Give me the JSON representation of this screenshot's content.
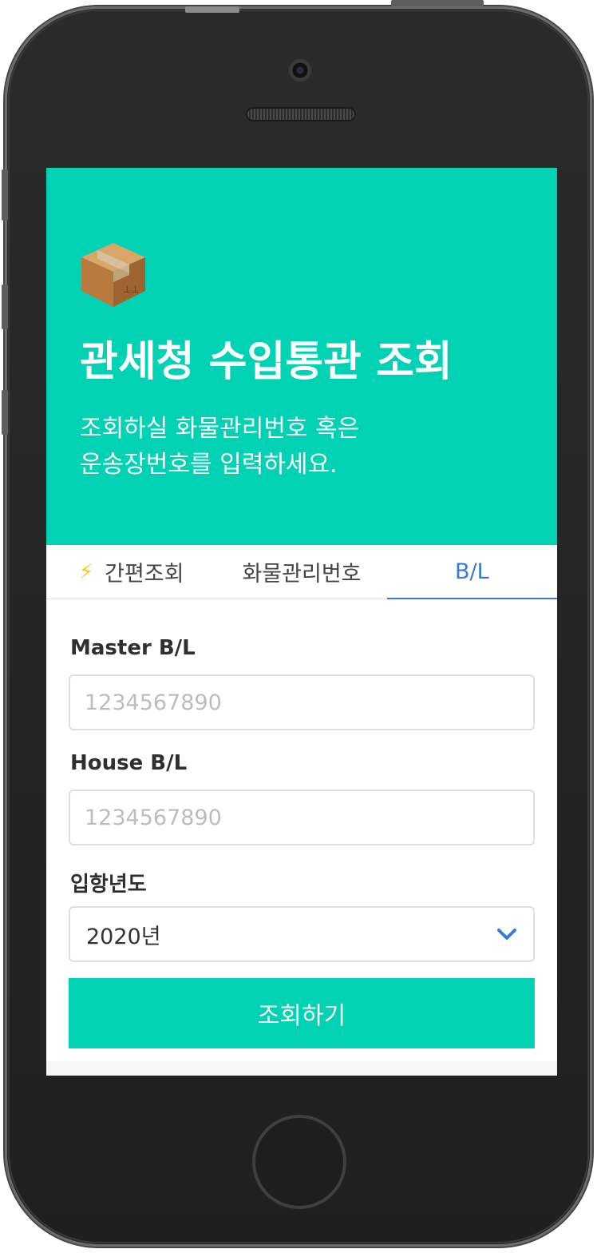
{
  "hero": {
    "title": "관세청 수입통관 조회",
    "subtitle": "조회하실 화물관리번호 혹은\n운송장번호를 입력하세요."
  },
  "tabs": [
    {
      "label": "간편조회",
      "icon": "lightning-icon",
      "active": false
    },
    {
      "label": "화물관리번호",
      "active": false
    },
    {
      "label": "B/L",
      "active": true
    }
  ],
  "form": {
    "master_label": "Master B/L",
    "master_placeholder": "1234567890",
    "house_label": "House B/L",
    "house_placeholder": "1234567890",
    "year_label": "입항년도",
    "year_value": "2020년",
    "submit_label": "조회하기"
  },
  "colors": {
    "accent": "#00d2b3",
    "active_tab": "#3a7bd5"
  }
}
